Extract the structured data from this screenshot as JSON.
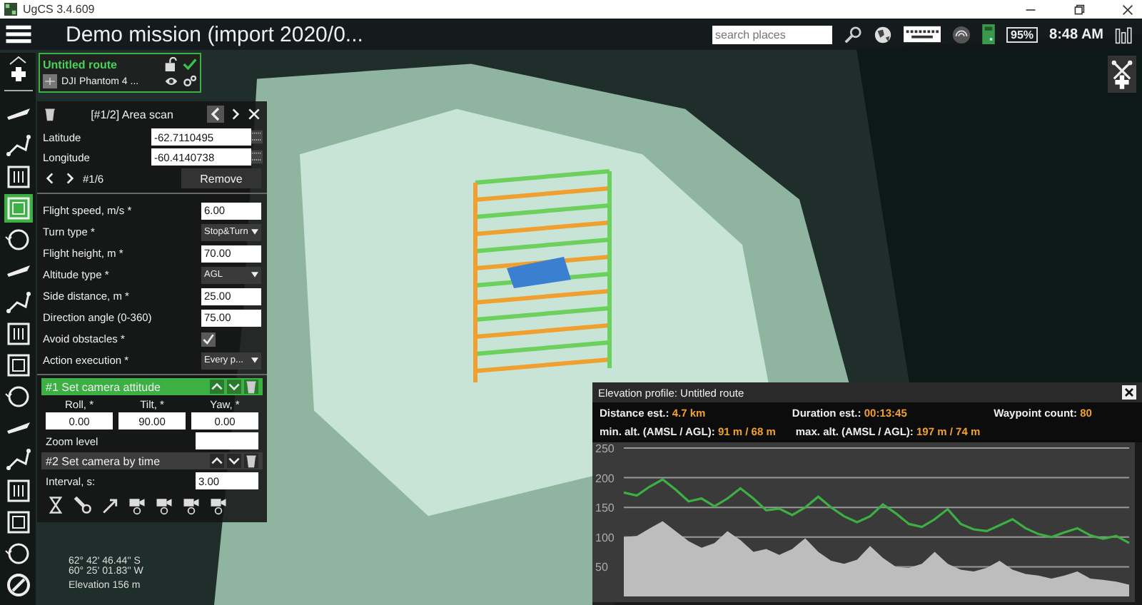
{
  "window": {
    "title": "UgCS 3.4.609"
  },
  "app_bar": {
    "mission_title": "Demo mission (import 2020/0...",
    "search": {
      "placeholder": "search places"
    },
    "battery": "95%",
    "time": "8:48 AM"
  },
  "route_card": {
    "name": "Untitled route",
    "vehicle": "DJI Phantom 4 ..."
  },
  "tools": [
    {
      "selected": false
    },
    {
      "selected": false
    },
    {
      "selected": false
    },
    {
      "selected": true
    },
    {
      "selected": false
    },
    {
      "selected": false
    },
    {
      "selected": false
    },
    {
      "selected": false
    },
    {
      "selected": false
    },
    {
      "selected": false
    },
    {
      "selected": false
    },
    {
      "selected": false
    },
    {
      "selected": false
    },
    {
      "selected": false
    },
    {
      "selected": false
    }
  ],
  "segment_panel": {
    "title": "[#1/2] Area scan",
    "latitude": {
      "label": "Latitude",
      "value": "-62.7110495"
    },
    "longitude": {
      "label": "Longitude",
      "value": "-60.4140738"
    },
    "point_index": "#1/6",
    "remove": "Remove",
    "params": [
      {
        "kind": "input",
        "label": "Flight speed, m/s *",
        "value": "6.00"
      },
      {
        "kind": "select",
        "label": "Turn type *",
        "value": "Stop&Turn"
      },
      {
        "kind": "input",
        "label": "Flight height, m *",
        "value": "70.00"
      },
      {
        "kind": "select",
        "label": "Altitude type *",
        "value": "AGL"
      },
      {
        "kind": "input",
        "label": "Side distance, m *",
        "value": "25.00"
      },
      {
        "kind": "input",
        "label": "Direction angle (0-360)",
        "value": "75.00"
      },
      {
        "kind": "checkbox",
        "label": "Avoid obstacles *",
        "checked": true
      },
      {
        "kind": "select",
        "label": "Action execution *",
        "value": "Every p..."
      }
    ],
    "actions": [
      {
        "title": "#1 Set camera attitude",
        "selected": true,
        "columns": [
          {
            "label": "Roll, *",
            "value": "0.00"
          },
          {
            "label": "Tilt, *",
            "value": "90.00"
          },
          {
            "label": "Yaw, *",
            "value": "0.00"
          }
        ],
        "rows": [
          {
            "label": "Zoom level"
          }
        ]
      },
      {
        "title": "#2 Set camera by time",
        "selected": false,
        "rows": [
          {
            "label": "Interval, s:",
            "value": "3.00"
          }
        ]
      }
    ]
  },
  "position": {
    "latitude": "62° 42' 46.44'' S",
    "longitude": "60° 25' 01.83'' W",
    "elevation": "Elevation 156 m"
  },
  "elevation_profile": {
    "title": "Elevation profile: Untitled route",
    "stats": [
      {
        "label": "Distance est.:",
        "value": "4.7 km"
      },
      {
        "label": "Duration est.:",
        "value": "00:13:45"
      },
      {
        "label": "Waypoint count:",
        "value": "80"
      },
      {
        "label": "min. alt. (AMSL / AGL):",
        "value": "91 m / 68 m"
      },
      {
        "label": "max. alt. (AMSL / AGL):",
        "value": "197 m / 74 m"
      }
    ],
    "chart_data": {
      "type": "line",
      "grid": true,
      "ylim": [
        0,
        250
      ],
      "yticks": [
        50,
        100,
        150,
        200,
        250
      ],
      "series": [
        {
          "type": "area",
          "color": "#bdbdbd",
          "values": [
            100,
            102,
            115,
            127,
            110,
            93,
            82,
            90,
            110,
            95,
            75,
            80,
            70,
            80,
            98,
            75,
            60,
            55,
            62,
            85,
            65,
            50,
            48,
            55,
            75,
            55,
            45,
            42,
            48,
            60,
            45,
            38,
            35,
            30,
            35,
            42,
            30,
            28,
            25,
            20
          ]
        },
        {
          "type": "line",
          "color": "#3cb043",
          "values": [
            175,
            170,
            185,
            197,
            180,
            160,
            165,
            152,
            165,
            182,
            165,
            145,
            148,
            137,
            150,
            168,
            150,
            135,
            125,
            135,
            155,
            140,
            122,
            117,
            130,
            147,
            122,
            113,
            110,
            120,
            130,
            115,
            105,
            100,
            108,
            115,
            103,
            97,
            102,
            90
          ]
        }
      ]
    }
  }
}
